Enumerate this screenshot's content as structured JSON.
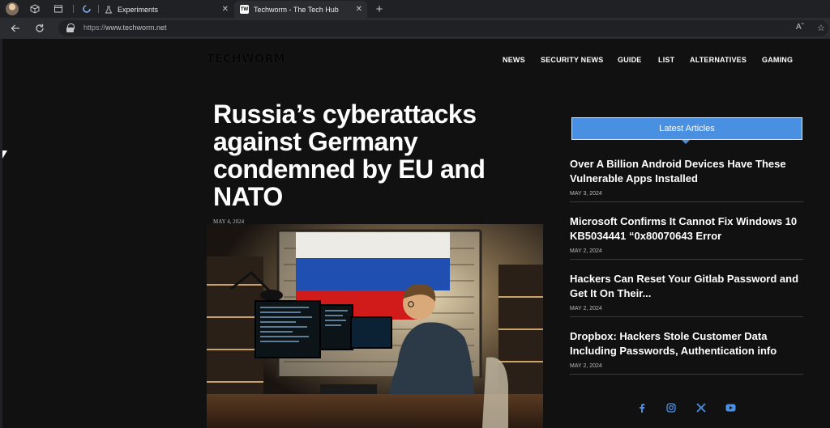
{
  "browser": {
    "tabs": [
      {
        "label": "Experiments",
        "favicon": "flask-icon",
        "active": false
      },
      {
        "label": "Techworm - The Tech Hub",
        "favicon": "TW",
        "active": true
      }
    ],
    "new_tab_glyph": "+",
    "url_prefix": "https://",
    "url_host": "www.techworm.net",
    "reader_mode_glyph": "Aˆ",
    "favorite_glyph": "☆"
  },
  "site": {
    "logo": "TECHWORM",
    "nav": [
      "NEWS",
      "SECURITY NEWS",
      "GUIDE",
      "LIST",
      "ALTERNATIVES",
      "GAMING"
    ]
  },
  "post": {
    "title_lines": [
      "Russia’s cyberattacks",
      "against Germany",
      "condemned by EU and",
      "NATO"
    ],
    "date": "MAY 4, 2024"
  },
  "sidebar": {
    "heading": "Latest Articles",
    "articles": [
      {
        "title": "Over A Billion Android Devices Have These Vulnerable Apps Installed",
        "date": "MAY 3, 2024"
      },
      {
        "title": "Microsoft Confirms It Cannot Fix Windows 10 KB5034441 “0x80070643 Error",
        "date": "MAY 2, 2024"
      },
      {
        "title": "Hackers Can Reset Your Gitlab Password and Get It On Their...",
        "date": "MAY 2, 2024"
      },
      {
        "title": "Dropbox: Hackers Stole Customer Data Including Passwords, Authentication info",
        "date": "MAY 2, 2024"
      }
    ],
    "social": [
      "facebook-icon",
      "instagram-icon",
      "x-icon",
      "youtube-icon"
    ]
  },
  "colors": {
    "accent": "#4a90e2",
    "page_bg": "#111111",
    "chrome_bg": "#202124"
  }
}
